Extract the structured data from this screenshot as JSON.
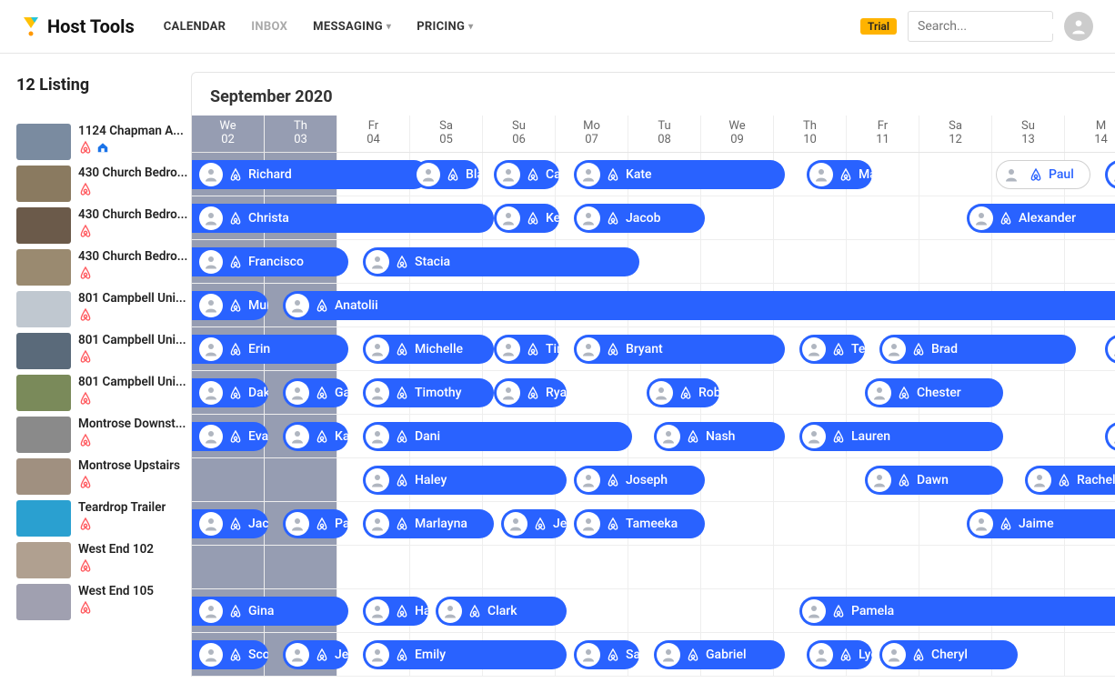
{
  "header": {
    "brand": "Host Tools",
    "nav": {
      "calendar": "CALENDAR",
      "inbox": "INBOX",
      "messaging": "MESSAGING",
      "pricing": "PRICING"
    },
    "trial": "Trial",
    "search_placeholder": "Search..."
  },
  "sidebar": {
    "title": "12 Listing",
    "listings": [
      {
        "name": "1124 Chapman A...",
        "platforms": [
          "airbnb",
          "vrbo"
        ]
      },
      {
        "name": "430 Church Bedro...",
        "platforms": [
          "airbnb"
        ]
      },
      {
        "name": "430 Church Bedro...",
        "platforms": [
          "airbnb"
        ]
      },
      {
        "name": "430 Church Bedro...",
        "platforms": [
          "airbnb"
        ]
      },
      {
        "name": "801 Campbell Uni...",
        "platforms": [
          "airbnb"
        ]
      },
      {
        "name": "801 Campbell Uni...",
        "platforms": [
          "airbnb"
        ]
      },
      {
        "name": "801 Campbell Uni...",
        "platforms": [
          "airbnb"
        ]
      },
      {
        "name": "Montrose Downst...",
        "platforms": [
          "airbnb"
        ]
      },
      {
        "name": "Montrose Upstairs",
        "platforms": [
          "airbnb"
        ]
      },
      {
        "name": "Teardrop Trailer",
        "platforms": [
          "airbnb"
        ]
      },
      {
        "name": "West End 102",
        "platforms": [
          "airbnb"
        ]
      },
      {
        "name": "West End 105",
        "platforms": [
          "airbnb"
        ]
      }
    ]
  },
  "calendar": {
    "title": "September 2020",
    "days": [
      {
        "dow": "We",
        "dom": "02",
        "past": true
      },
      {
        "dow": "Th",
        "dom": "03",
        "past": true
      },
      {
        "dow": "Fr",
        "dom": "04",
        "past": false
      },
      {
        "dow": "Sa",
        "dom": "05",
        "past": false
      },
      {
        "dow": "Su",
        "dom": "06",
        "past": false
      },
      {
        "dow": "Mo",
        "dom": "07",
        "past": false
      },
      {
        "dow": "Tu",
        "dom": "08",
        "past": false
      },
      {
        "dow": "We",
        "dom": "09",
        "past": false
      },
      {
        "dow": "Th",
        "dom": "10",
        "past": false
      },
      {
        "dow": "Fr",
        "dom": "11",
        "past": false
      },
      {
        "dow": "Sa",
        "dom": "12",
        "past": false
      },
      {
        "dow": "Su",
        "dom": "13",
        "past": false
      },
      {
        "dow": "M",
        "dom": "14",
        "past": false
      }
    ],
    "rows": [
      [
        {
          "name": "Richard",
          "start": 0,
          "span": 3.3,
          "left_cut": true
        },
        {
          "name": "Bla",
          "start": 3,
          "span": 1
        },
        {
          "name": "Car",
          "start": 4.1,
          "span": 1
        },
        {
          "name": "Kate",
          "start": 5.2,
          "span": 3
        },
        {
          "name": "Ma",
          "start": 8.4,
          "span": 1
        },
        {
          "name": "Paul",
          "start": 11,
          "span": 1.4,
          "white": true
        },
        {
          "name": "",
          "start": 12.5,
          "span": 0.5,
          "right_cut": true
        }
      ],
      [
        {
          "name": "Christa",
          "start": 0,
          "span": 4.2,
          "left_cut": true
        },
        {
          "name": "Ker",
          "start": 4.1,
          "span": 1
        },
        {
          "name": "Jacob",
          "start": 5.2,
          "span": 1.9
        },
        {
          "name": "Alexander",
          "start": 10.6,
          "span": 2.4,
          "right_cut": true
        }
      ],
      [
        {
          "name": "Francisco",
          "start": 0,
          "span": 2.2,
          "left_cut": true
        },
        {
          "name": "Stacia",
          "start": 2.3,
          "span": 3.9
        }
      ],
      [
        {
          "name": "Muh",
          "start": 0,
          "span": 1.1,
          "left_cut": true
        },
        {
          "name": "Anatolii",
          "start": 1.2,
          "span": 11.8,
          "right_cut": true
        }
      ],
      [
        {
          "name": "Erin",
          "start": 0,
          "span": 2.2,
          "left_cut": true
        },
        {
          "name": "Michelle",
          "start": 2.3,
          "span": 1.9
        },
        {
          "name": "Tim",
          "start": 4.1,
          "span": 1
        },
        {
          "name": "Bryant",
          "start": 5.2,
          "span": 3
        },
        {
          "name": "Ter",
          "start": 8.3,
          "span": 1
        },
        {
          "name": "Brad",
          "start": 9.4,
          "span": 2.8
        },
        {
          "name": "",
          "start": 12.5,
          "span": 0.5,
          "right_cut": true
        }
      ],
      [
        {
          "name": "Dako",
          "start": 0,
          "span": 1.1,
          "left_cut": true
        },
        {
          "name": "Gab",
          "start": 1.2,
          "span": 1
        },
        {
          "name": "Timothy",
          "start": 2.3,
          "span": 1.9
        },
        {
          "name": "Rya",
          "start": 4.1,
          "span": 1.1
        },
        {
          "name": "Robi",
          "start": 6.2,
          "span": 1.1
        },
        {
          "name": "Chester",
          "start": 9.2,
          "span": 2
        }
      ],
      [
        {
          "name": "Eval",
          "start": 0,
          "span": 1.1,
          "left_cut": true
        },
        {
          "name": "Kat",
          "start": 1.2,
          "span": 1
        },
        {
          "name": "Dani",
          "start": 2.3,
          "span": 3.8
        },
        {
          "name": "Nash",
          "start": 6.3,
          "span": 1.9
        },
        {
          "name": "Lauren",
          "start": 8.3,
          "span": 2.9
        },
        {
          "name": "",
          "start": 12.5,
          "span": 0.5,
          "right_cut": true
        }
      ],
      [
        {
          "name": "Haley",
          "start": 2.3,
          "span": 2.9
        },
        {
          "name": "Joseph",
          "start": 5.2,
          "span": 1.9
        },
        {
          "name": "Dawn",
          "start": 9.2,
          "span": 2
        },
        {
          "name": "Rachel",
          "start": 11.4,
          "span": 1.6,
          "right_cut": true
        }
      ],
      [
        {
          "name": "Jack",
          "start": 0,
          "span": 1.1,
          "left_cut": true
        },
        {
          "name": "Pat",
          "start": 1.2,
          "span": 1
        },
        {
          "name": "Marlayna",
          "start": 2.3,
          "span": 1.9
        },
        {
          "name": "Jef",
          "start": 4.2,
          "span": 1
        },
        {
          "name": "Tameeka",
          "start": 5.2,
          "span": 1.9
        },
        {
          "name": "Jaime",
          "start": 10.6,
          "span": 2.4,
          "right_cut": true
        }
      ],
      [],
      [
        {
          "name": "Gina",
          "start": 0,
          "span": 2.2,
          "left_cut": true
        },
        {
          "name": "Hal",
          "start": 2.3,
          "span": 1
        },
        {
          "name": "Clark",
          "start": 3.3,
          "span": 1.9
        },
        {
          "name": "Pamela",
          "start": 8.3,
          "span": 4.7,
          "right_cut": true
        }
      ],
      [
        {
          "name": "Scot",
          "start": 0,
          "span": 1.1,
          "left_cut": true
        },
        {
          "name": "Jer",
          "start": 1.2,
          "span": 1
        },
        {
          "name": "Emily",
          "start": 2.3,
          "span": 2.9
        },
        {
          "name": "Sar",
          "start": 5.2,
          "span": 1
        },
        {
          "name": "Gabriel",
          "start": 6.3,
          "span": 1.9
        },
        {
          "name": "Lyd",
          "start": 8.4,
          "span": 1
        },
        {
          "name": "Cheryl",
          "start": 9.4,
          "span": 2
        }
      ]
    ]
  },
  "colors": {
    "booking": "#2962ff",
    "past": "#969db2",
    "airbnb": "#ff5a5f"
  }
}
